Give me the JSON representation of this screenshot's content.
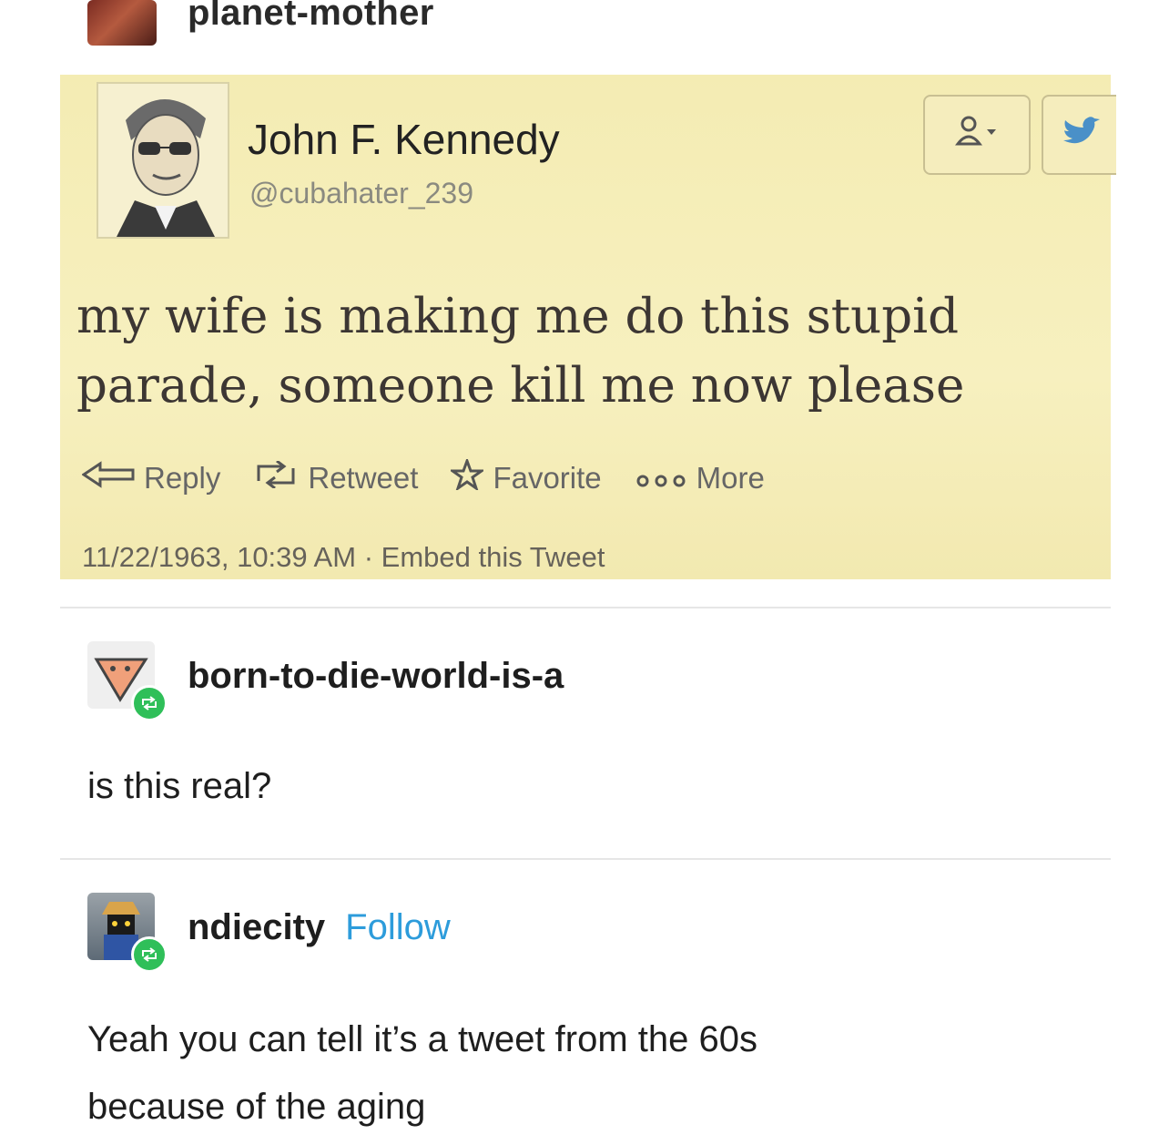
{
  "original_poster": {
    "username": "planet-mother"
  },
  "tweet": {
    "display_name": "John F. Kennedy",
    "handle": "@cubahater_239",
    "text_line1": "my wife is making me do this stupid",
    "text_line2": "parade, someone kill me now please",
    "actions": {
      "reply": "Reply",
      "retweet": "Retweet",
      "favorite": "Favorite",
      "more": "More"
    },
    "timestamp": "11/22/1963, 10:39 AM",
    "separator": "·",
    "embed": "Embed this Tweet",
    "background_color": "#f4ecb3"
  },
  "reblogs": [
    {
      "username": "born-to-die-world-is-a",
      "text": "is this real?"
    },
    {
      "username": "ndiecity",
      "follow_label": "Follow",
      "text_line1": "Yeah you can tell it’s a tweet from the 60s",
      "text_line2": "because of the aging"
    }
  ],
  "colors": {
    "follow": "#2d9cdb",
    "reblog_badge": "#2fbf59"
  }
}
